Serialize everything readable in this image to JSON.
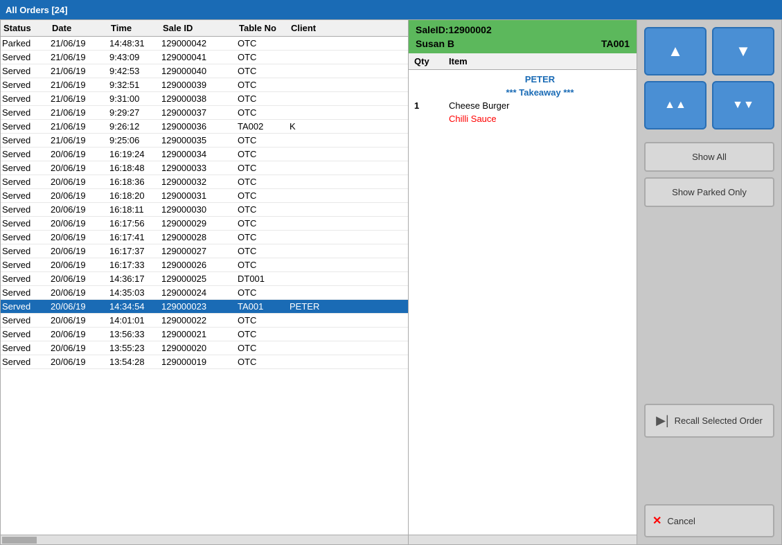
{
  "titleBar": {
    "label": "All Orders [24]"
  },
  "ordersTable": {
    "headers": [
      "Status",
      "Date",
      "Time",
      "Sale ID",
      "Table No",
      "Client"
    ],
    "rows": [
      {
        "status": "Parked",
        "date": "21/06/19",
        "time": "14:48:31",
        "saleId": "129000042",
        "tableNo": "OTC",
        "client": ""
      },
      {
        "status": "Served",
        "date": "21/06/19",
        "time": "9:43:09",
        "saleId": "129000041",
        "tableNo": "OTC",
        "client": ""
      },
      {
        "status": "Served",
        "date": "21/06/19",
        "time": "9:42:53",
        "saleId": "129000040",
        "tableNo": "OTC",
        "client": ""
      },
      {
        "status": "Served",
        "date": "21/06/19",
        "time": "9:32:51",
        "saleId": "129000039",
        "tableNo": "OTC",
        "client": ""
      },
      {
        "status": "Served",
        "date": "21/06/19",
        "time": "9:31:00",
        "saleId": "129000038",
        "tableNo": "OTC",
        "client": ""
      },
      {
        "status": "Served",
        "date": "21/06/19",
        "time": "9:29:27",
        "saleId": "129000037",
        "tableNo": "OTC",
        "client": ""
      },
      {
        "status": "Served",
        "date": "21/06/19",
        "time": "9:26:12",
        "saleId": "129000036",
        "tableNo": "TA002",
        "client": "K"
      },
      {
        "status": "Served",
        "date": "21/06/19",
        "time": "9:25:06",
        "saleId": "129000035",
        "tableNo": "OTC",
        "client": ""
      },
      {
        "status": "Served",
        "date": "20/06/19",
        "time": "16:19:24",
        "saleId": "129000034",
        "tableNo": "OTC",
        "client": ""
      },
      {
        "status": "Served",
        "date": "20/06/19",
        "time": "16:18:48",
        "saleId": "129000033",
        "tableNo": "OTC",
        "client": ""
      },
      {
        "status": "Served",
        "date": "20/06/19",
        "time": "16:18:36",
        "saleId": "129000032",
        "tableNo": "OTC",
        "client": ""
      },
      {
        "status": "Served",
        "date": "20/06/19",
        "time": "16:18:20",
        "saleId": "129000031",
        "tableNo": "OTC",
        "client": ""
      },
      {
        "status": "Served",
        "date": "20/06/19",
        "time": "16:18:11",
        "saleId": "129000030",
        "tableNo": "OTC",
        "client": ""
      },
      {
        "status": "Served",
        "date": "20/06/19",
        "time": "16:17:56",
        "saleId": "129000029",
        "tableNo": "OTC",
        "client": ""
      },
      {
        "status": "Served",
        "date": "20/06/19",
        "time": "16:17:41",
        "saleId": "129000028",
        "tableNo": "OTC",
        "client": ""
      },
      {
        "status": "Served",
        "date": "20/06/19",
        "time": "16:17:37",
        "saleId": "129000027",
        "tableNo": "OTC",
        "client": ""
      },
      {
        "status": "Served",
        "date": "20/06/19",
        "time": "16:17:33",
        "saleId": "129000026",
        "tableNo": "OTC",
        "client": ""
      },
      {
        "status": "Served",
        "date": "20/06/19",
        "time": "14:36:17",
        "saleId": "129000025",
        "tableNo": "DT001",
        "client": ""
      },
      {
        "status": "Served",
        "date": "20/06/19",
        "time": "14:35:03",
        "saleId": "129000024",
        "tableNo": "OTC",
        "client": ""
      },
      {
        "status": "Served",
        "date": "20/06/19",
        "time": "14:34:54",
        "saleId": "129000023",
        "tableNo": "TA001",
        "client": "PETER",
        "selected": true
      },
      {
        "status": "Served",
        "date": "20/06/19",
        "time": "14:01:01",
        "saleId": "129000022",
        "tableNo": "OTC",
        "client": ""
      },
      {
        "status": "Served",
        "date": "20/06/19",
        "time": "13:56:33",
        "saleId": "129000021",
        "tableNo": "OTC",
        "client": ""
      },
      {
        "status": "Served",
        "date": "20/06/19",
        "time": "13:55:23",
        "saleId": "129000020",
        "tableNo": "OTC",
        "client": ""
      },
      {
        "status": "Served",
        "date": "20/06/19",
        "time": "13:54:28",
        "saleId": "129000019",
        "tableNo": "OTC",
        "client": ""
      }
    ]
  },
  "orderDetail": {
    "saleIdLabel": "SaleID:12900002",
    "customerName": "Susan B",
    "tableNo": "TA001",
    "qtyHeader": "Qty",
    "itemHeader": "Item",
    "items": [
      {
        "qty": "",
        "name": "PETER",
        "type": "blue"
      },
      {
        "qty": "",
        "name": "*** Takeaway ***",
        "type": "blue"
      },
      {
        "qty": "1",
        "name": "Cheese Burger",
        "type": "black"
      },
      {
        "qty": "",
        "name": "Chilli Sauce",
        "type": "red"
      }
    ]
  },
  "buttons": {
    "scrollUpLabel": "▲",
    "scrollDownLabel": "▼",
    "scrollTopLabel": "▲▲",
    "scrollBottomLabel": "▼▼",
    "showAllLabel": "Show All",
    "showParkedOnlyLabel": "Show Parked Only",
    "recallSelectedOrderLabel": "Recall Selected Order",
    "cancelLabel": "Cancel"
  },
  "icons": {
    "recallIcon": "▶|",
    "cancelIcon": "✕"
  }
}
